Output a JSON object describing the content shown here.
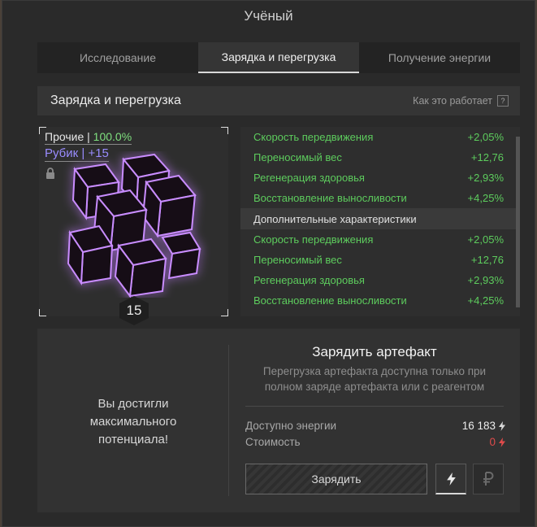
{
  "window": {
    "title": "Учёный"
  },
  "tabs": [
    {
      "label": "Исследование"
    },
    {
      "label": "Зарядка и перегрузка"
    },
    {
      "label": "Получение энергии"
    }
  ],
  "section": {
    "title": "Зарядка и перегрузка",
    "how_label": "Как это работает",
    "how_icon": "?"
  },
  "artifact": {
    "durability_label": "Прочие",
    "durability_value": "100.0%",
    "grade": "Рубик | +15",
    "level": "15",
    "locked": true
  },
  "stats": {
    "main": [
      {
        "name": "Скорость передвижения",
        "value": "+2,05%"
      },
      {
        "name": "Переносимый вес",
        "value": "+12,76"
      },
      {
        "name": "Регенерация здоровья",
        "value": "+2,93%"
      },
      {
        "name": "Восстановление выносливости",
        "value": "+4,25%"
      }
    ],
    "extra_header": "Дополнительные характеристики",
    "extra": [
      {
        "name": "Скорость передвижения",
        "value": "+2,05%"
      },
      {
        "name": "Переносимый вес",
        "value": "+12,76"
      },
      {
        "name": "Регенерация здоровья",
        "value": "+2,93%"
      },
      {
        "name": "Восстановление выносливости",
        "value": "+4,25%"
      }
    ]
  },
  "bottom": {
    "max_message": "Вы достигли максимального потенциала!",
    "charge_title": "Зарядить артефакт",
    "charge_desc": "Перегрузка артефакта доступна только при полном заряде артефакта или с реагентом",
    "energy_label": "Доступно энергии",
    "energy_value": "16 183",
    "cost_label": "Стоимость",
    "cost_value": "0",
    "charge_button": "Зарядить"
  },
  "colors": {
    "green": "#5dcc5d",
    "red": "#e04b4b",
    "purple": "#9a8cff"
  }
}
